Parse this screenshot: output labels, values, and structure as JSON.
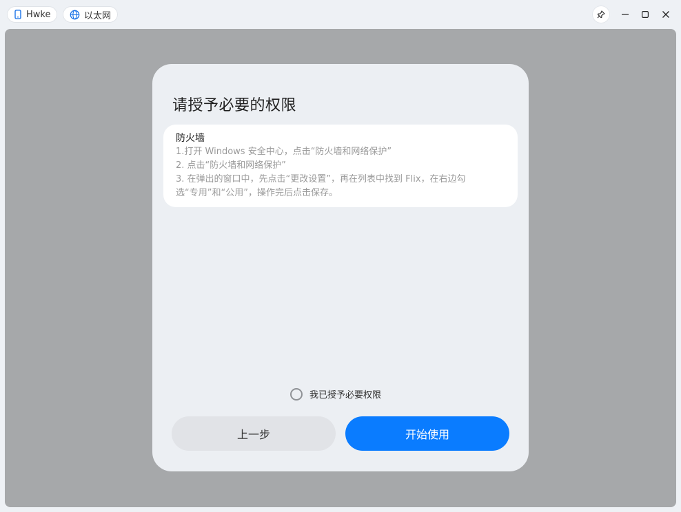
{
  "titlebar": {
    "device_label": "Hwke",
    "network_label": "以太网"
  },
  "icons": {
    "device": "phone-icon",
    "network": "globe-icon",
    "pin": "pin-icon",
    "minimize": "minimize-icon",
    "maximize": "maximize-icon",
    "close": "close-icon"
  },
  "colors": {
    "accent": "#0a7cff",
    "overlay": "#a6a8aa",
    "dialog_bg": "#eceff3"
  },
  "dialog": {
    "title": "请授予必要的权限",
    "card": {
      "heading": "防火墙",
      "lines": [
        "1.打开 Windows 安全中心，点击“防火墙和网络保护”",
        "2. 点击“防火墙和网络保护”",
        "3. 在弹出的窗口中，先点击“更改设置”，再在列表中找到 Flix，在右边勾",
        "选“专用”和“公用”，操作完后点击保存。"
      ]
    },
    "confirm_label": "我已授予必要权限",
    "confirm_checked": false,
    "prev_button": "上一步",
    "start_button": "开始使用"
  }
}
